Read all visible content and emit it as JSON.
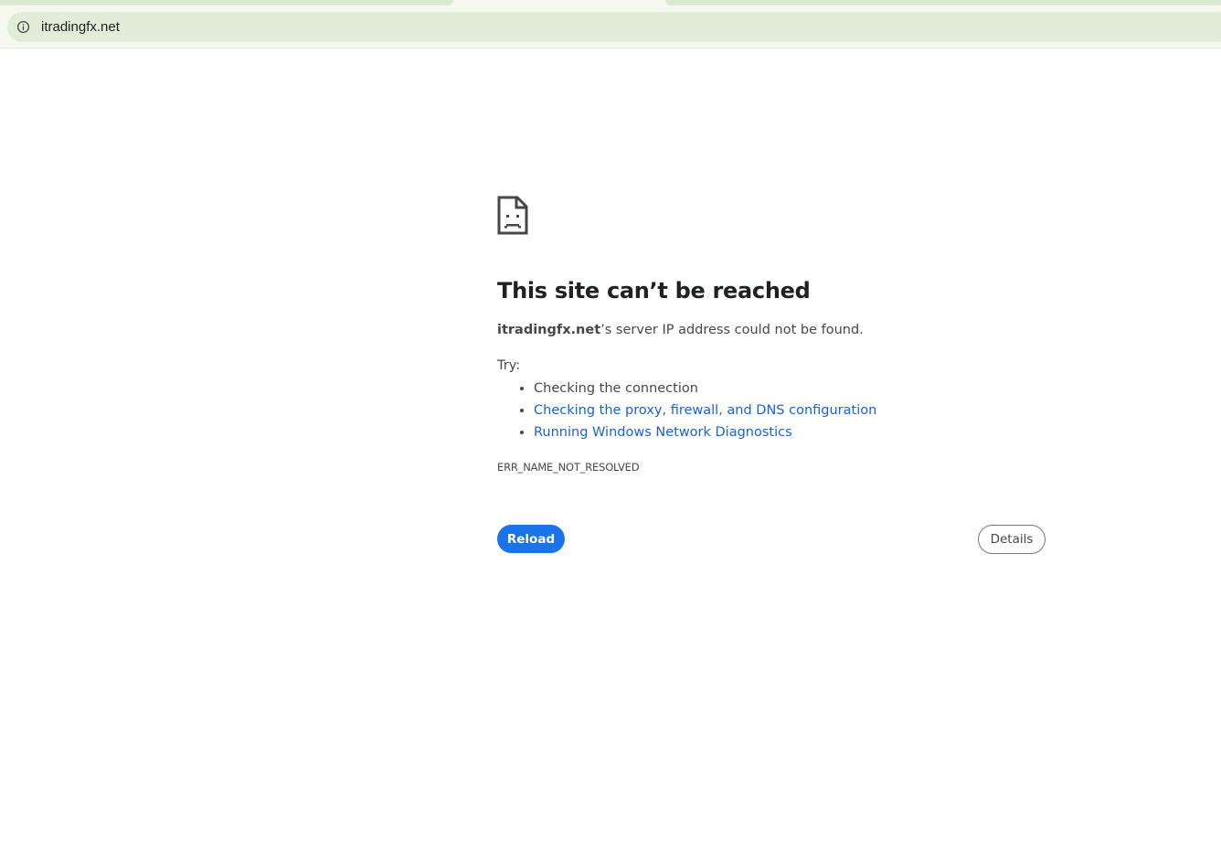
{
  "browser": {
    "url": "itradingfx.net",
    "icons": {
      "site_info": "info-icon"
    }
  },
  "error_page": {
    "icon": "sad-document-icon",
    "title": "This site can’t be reached",
    "description": {
      "host": "itradingfx.net",
      "rest": "’s server IP address could not be found."
    },
    "try_label": "Try:",
    "suggestions": [
      {
        "text": "Checking the connection",
        "link": false
      },
      {
        "text": "Checking the proxy, firewall, and DNS configuration",
        "link": true
      },
      {
        "text": "Running Windows Network Diagnostics",
        "link": true
      }
    ],
    "error_code": "ERR_NAME_NOT_RESOLVED",
    "reload_label": "Reload",
    "details_label": "Details"
  },
  "colors": {
    "link": "#1a62d1",
    "primary_button": "#1a73e8",
    "toolbar_bg": "#f4f8ef",
    "omnibox_bg": "#e3ecd9"
  }
}
